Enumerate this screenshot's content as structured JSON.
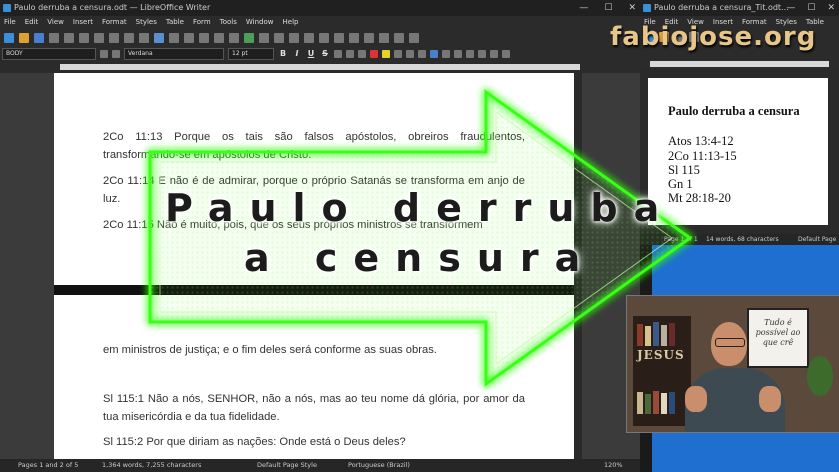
{
  "main_window": {
    "title": "Paulo derruba a censura.odt — LibreOffice Writer",
    "controls": [
      "—",
      "☐",
      "✕"
    ],
    "menu": [
      "File",
      "Edit",
      "View",
      "Insert",
      "Format",
      "Styles",
      "Table",
      "Form",
      "Tools",
      "Window",
      "Help"
    ],
    "para_style": "BODY",
    "font_name": "Verdana",
    "font_size": "12 pt",
    "format_buttons": [
      "B",
      "I",
      "U",
      "S"
    ],
    "paragraphs_page1": [
      "2Co 11:13 Porque os tais são falsos apóstolos, obreiros fraudulentos, transformando-se em apóstolos de Cristo.",
      "2Co 11:14 E não é de admirar, porque o próprio Satanás se transforma em anjo de luz.",
      "2Co 11:15 Não é muito, pois, que os seus próprios ministros se transformem"
    ],
    "paragraphs_page2": [
      "em ministros de justiça; e o fim deles será conforme as suas obras.",
      "Sl 115:1  Não a nós, SENHOR, não a nós, mas ao teu nome dá glória, por amor da tua misericórdia e da tua fidelidade.",
      "Sl 115:2  Por que diriam as nações: Onde está o Deus deles?"
    ],
    "status": {
      "page": "Pages 1 and 2 of 5",
      "words": "1,364 words, 7,255 characters",
      "page_style": "Default Page Style",
      "language": "Portuguese (Brazil)",
      "zoom": "120%"
    }
  },
  "side_window": {
    "title": "Paulo derruba a censura_Tit.odt...",
    "controls": [
      "—",
      "☐",
      "✕"
    ],
    "menu": [
      "File",
      "Edit",
      "View",
      "Insert",
      "Format",
      "Styles",
      "Table"
    ],
    "doc_title": "Paulo derruba a censura",
    "refs": [
      "Atos 13:4-12",
      "2Co 11:13-15",
      "Sl 115",
      "Gn 1",
      "Mt 28:18-20"
    ],
    "status": {
      "page": "Page 1 of 1",
      "words": "14 words, 68 characters",
      "page_style": "Default Page"
    }
  },
  "overlay": {
    "title_line1": "Paulo derruba",
    "title_line2": "a censura",
    "watermark": "fabiojose.org",
    "glow_color": "#39ff14"
  },
  "webcam": {
    "shelf_text": "JESUS",
    "sign_text": "Tudo é possível ao que crê"
  }
}
